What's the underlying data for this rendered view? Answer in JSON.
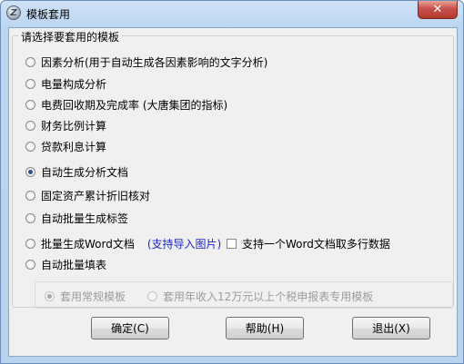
{
  "window": {
    "title": "模板套用",
    "app_icon_letter": "Z",
    "close_glyph": "✕"
  },
  "group": {
    "legend": "请选择要套用的模板"
  },
  "options": [
    {
      "label": "因素分析(用于自动生成各因素影响的文字分析)",
      "checked": false
    },
    {
      "label": "电量构成分析",
      "checked": false
    },
    {
      "label": "电费回收期及完成率 (大唐集团的指标)",
      "checked": false
    },
    {
      "label": "财务比例计算",
      "checked": false
    },
    {
      "label": "贷款利息计算",
      "checked": false
    },
    {
      "label": "自动生成分析文档",
      "checked": true
    },
    {
      "label": "固定资产累计折旧核对",
      "checked": false
    },
    {
      "label": "自动批量生成标签",
      "checked": false
    },
    {
      "label": "批量生成Word文档",
      "checked": false
    },
    {
      "label": "自动批量填表",
      "checked": false
    }
  ],
  "word_import_hint": "(支持导入图片)",
  "word_multirow_checkbox": {
    "label": "支持一个Word文档取多行数据",
    "checked": false
  },
  "sub_options": [
    {
      "label": "套用常规模板",
      "checked": true,
      "disabled": true
    },
    {
      "label": "套用年收入12万元以上个税申报表专用模板",
      "checked": false,
      "disabled": true
    }
  ],
  "buttons": {
    "ok": "确定(C)",
    "help": "帮助(H)",
    "exit": "退出(X)"
  }
}
